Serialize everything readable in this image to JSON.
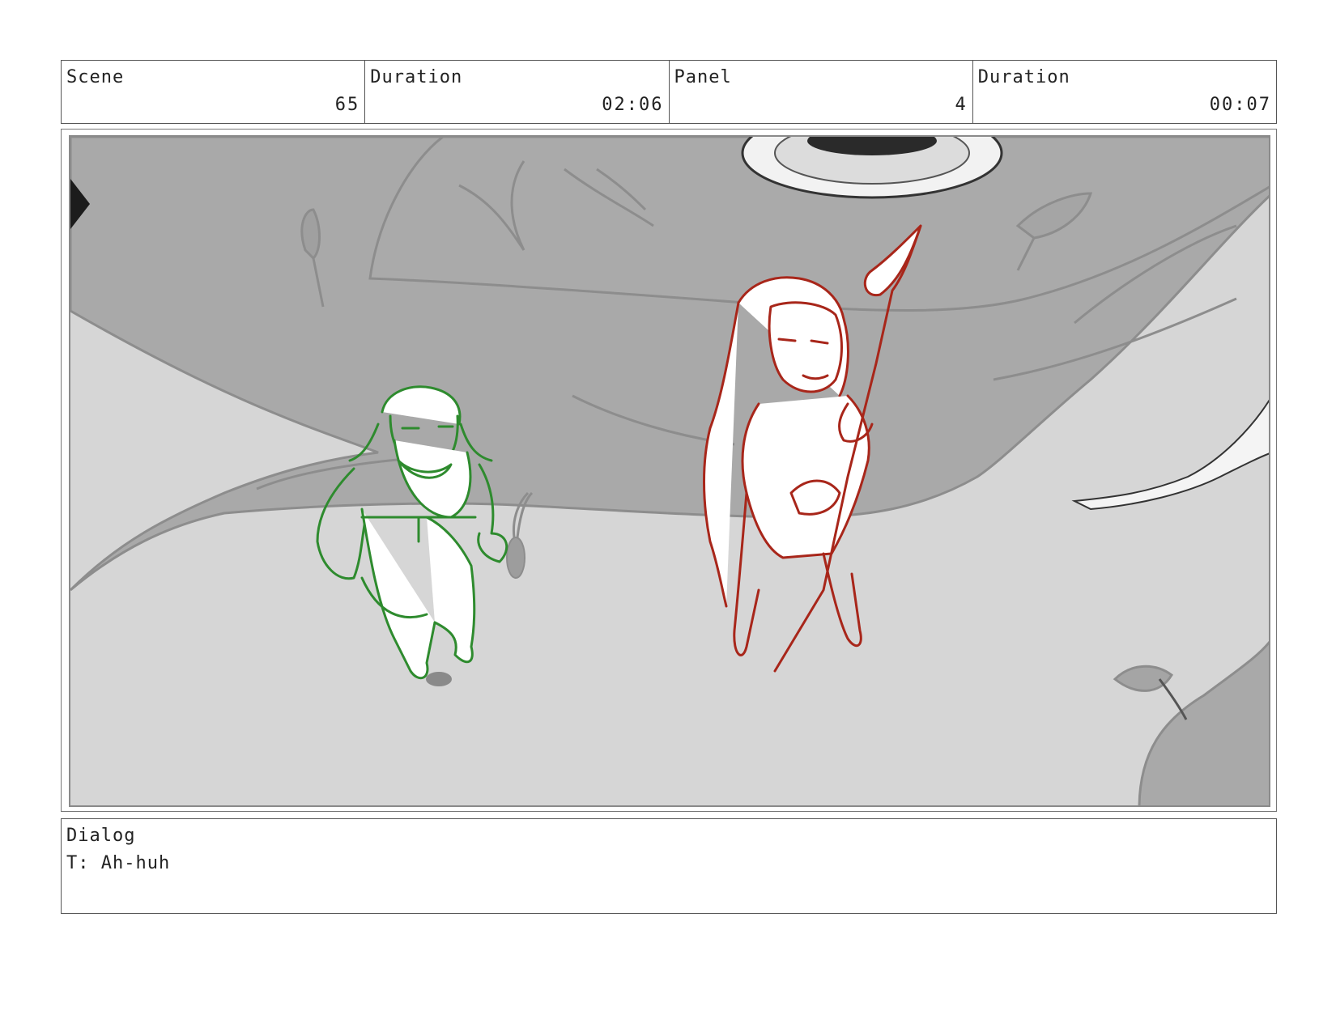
{
  "header": {
    "scene_label": "Scene",
    "scene_value": "65",
    "scene_duration_label": "Duration",
    "scene_duration_value": "02:06",
    "panel_label": "Panel",
    "panel_value": "4",
    "panel_duration_label": "Duration",
    "panel_duration_value": "00:07"
  },
  "dialog": {
    "label": "Dialog",
    "line": "T: Ah-huh"
  },
  "colors": {
    "dwarf_sketch": "#2e8b2e",
    "elf_sketch": "#a8261a",
    "background_light": "#d6d6d6",
    "background_mid": "#a9a9a9"
  }
}
